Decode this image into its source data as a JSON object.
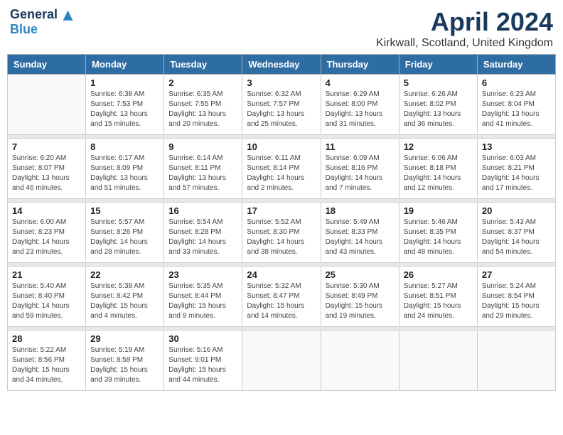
{
  "logo": {
    "general": "General",
    "blue": "Blue"
  },
  "title": "April 2024",
  "location": "Kirkwall, Scotland, United Kingdom",
  "days_of_week": [
    "Sunday",
    "Monday",
    "Tuesday",
    "Wednesday",
    "Thursday",
    "Friday",
    "Saturday"
  ],
  "weeks": [
    [
      {
        "day": "",
        "info": ""
      },
      {
        "day": "1",
        "info": "Sunrise: 6:38 AM\nSunset: 7:53 PM\nDaylight: 13 hours\nand 15 minutes."
      },
      {
        "day": "2",
        "info": "Sunrise: 6:35 AM\nSunset: 7:55 PM\nDaylight: 13 hours\nand 20 minutes."
      },
      {
        "day": "3",
        "info": "Sunrise: 6:32 AM\nSunset: 7:57 PM\nDaylight: 13 hours\nand 25 minutes."
      },
      {
        "day": "4",
        "info": "Sunrise: 6:29 AM\nSunset: 8:00 PM\nDaylight: 13 hours\nand 31 minutes."
      },
      {
        "day": "5",
        "info": "Sunrise: 6:26 AM\nSunset: 8:02 PM\nDaylight: 13 hours\nand 36 minutes."
      },
      {
        "day": "6",
        "info": "Sunrise: 6:23 AM\nSunset: 8:04 PM\nDaylight: 13 hours\nand 41 minutes."
      }
    ],
    [
      {
        "day": "7",
        "info": "Sunrise: 6:20 AM\nSunset: 8:07 PM\nDaylight: 13 hours\nand 46 minutes."
      },
      {
        "day": "8",
        "info": "Sunrise: 6:17 AM\nSunset: 8:09 PM\nDaylight: 13 hours\nand 51 minutes."
      },
      {
        "day": "9",
        "info": "Sunrise: 6:14 AM\nSunset: 8:11 PM\nDaylight: 13 hours\nand 57 minutes."
      },
      {
        "day": "10",
        "info": "Sunrise: 6:11 AM\nSunset: 8:14 PM\nDaylight: 14 hours\nand 2 minutes."
      },
      {
        "day": "11",
        "info": "Sunrise: 6:09 AM\nSunset: 8:16 PM\nDaylight: 14 hours\nand 7 minutes."
      },
      {
        "day": "12",
        "info": "Sunrise: 6:06 AM\nSunset: 8:18 PM\nDaylight: 14 hours\nand 12 minutes."
      },
      {
        "day": "13",
        "info": "Sunrise: 6:03 AM\nSunset: 8:21 PM\nDaylight: 14 hours\nand 17 minutes."
      }
    ],
    [
      {
        "day": "14",
        "info": "Sunrise: 6:00 AM\nSunset: 8:23 PM\nDaylight: 14 hours\nand 23 minutes."
      },
      {
        "day": "15",
        "info": "Sunrise: 5:57 AM\nSunset: 8:26 PM\nDaylight: 14 hours\nand 28 minutes."
      },
      {
        "day": "16",
        "info": "Sunrise: 5:54 AM\nSunset: 8:28 PM\nDaylight: 14 hours\nand 33 minutes."
      },
      {
        "day": "17",
        "info": "Sunrise: 5:52 AM\nSunset: 8:30 PM\nDaylight: 14 hours\nand 38 minutes."
      },
      {
        "day": "18",
        "info": "Sunrise: 5:49 AM\nSunset: 8:33 PM\nDaylight: 14 hours\nand 43 minutes."
      },
      {
        "day": "19",
        "info": "Sunrise: 5:46 AM\nSunset: 8:35 PM\nDaylight: 14 hours\nand 48 minutes."
      },
      {
        "day": "20",
        "info": "Sunrise: 5:43 AM\nSunset: 8:37 PM\nDaylight: 14 hours\nand 54 minutes."
      }
    ],
    [
      {
        "day": "21",
        "info": "Sunrise: 5:40 AM\nSunset: 8:40 PM\nDaylight: 14 hours\nand 59 minutes."
      },
      {
        "day": "22",
        "info": "Sunrise: 5:38 AM\nSunset: 8:42 PM\nDaylight: 15 hours\nand 4 minutes."
      },
      {
        "day": "23",
        "info": "Sunrise: 5:35 AM\nSunset: 8:44 PM\nDaylight: 15 hours\nand 9 minutes."
      },
      {
        "day": "24",
        "info": "Sunrise: 5:32 AM\nSunset: 8:47 PM\nDaylight: 15 hours\nand 14 minutes."
      },
      {
        "day": "25",
        "info": "Sunrise: 5:30 AM\nSunset: 8:49 PM\nDaylight: 15 hours\nand 19 minutes."
      },
      {
        "day": "26",
        "info": "Sunrise: 5:27 AM\nSunset: 8:51 PM\nDaylight: 15 hours\nand 24 minutes."
      },
      {
        "day": "27",
        "info": "Sunrise: 5:24 AM\nSunset: 8:54 PM\nDaylight: 15 hours\nand 29 minutes."
      }
    ],
    [
      {
        "day": "28",
        "info": "Sunrise: 5:22 AM\nSunset: 8:56 PM\nDaylight: 15 hours\nand 34 minutes."
      },
      {
        "day": "29",
        "info": "Sunrise: 5:19 AM\nSunset: 8:58 PM\nDaylight: 15 hours\nand 39 minutes."
      },
      {
        "day": "30",
        "info": "Sunrise: 5:16 AM\nSunset: 9:01 PM\nDaylight: 15 hours\nand 44 minutes."
      },
      {
        "day": "",
        "info": ""
      },
      {
        "day": "",
        "info": ""
      },
      {
        "day": "",
        "info": ""
      },
      {
        "day": "",
        "info": ""
      }
    ]
  ]
}
